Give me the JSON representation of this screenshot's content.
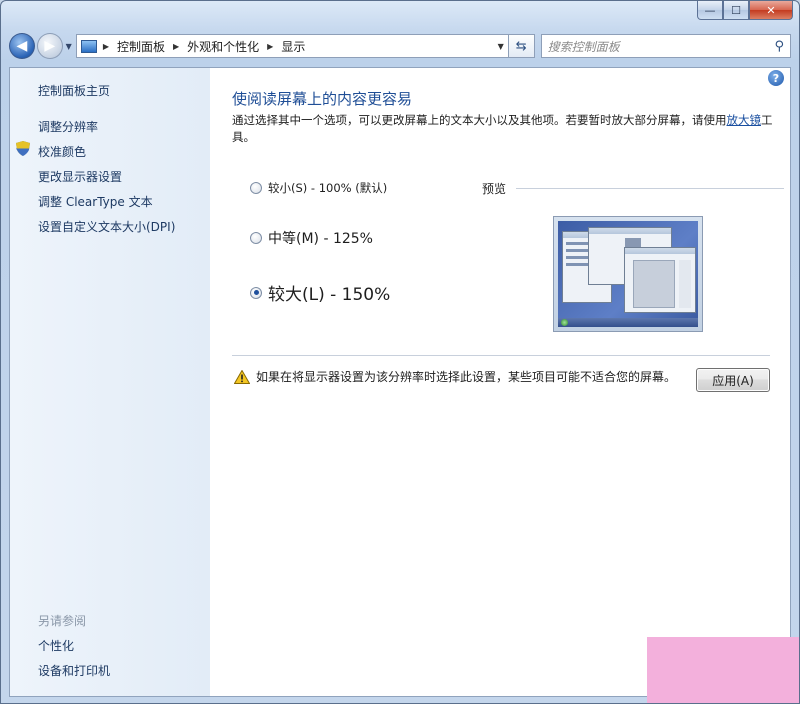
{
  "window": {
    "caption_buttons": {
      "minimize": "—",
      "maximize": "☐",
      "close": "✕"
    }
  },
  "navbar": {
    "back_icon": "arrow-left-icon",
    "forward_icon": "arrow-right-icon",
    "breadcrumbs": [
      "控制面板",
      "外观和个性化",
      "显示"
    ],
    "search_placeholder": "搜索控制面板"
  },
  "sidebar": {
    "items": [
      {
        "label": "控制面板主页"
      },
      {
        "label": "调整分辨率"
      },
      {
        "label": "校准颜色",
        "icon": "shield-icon"
      },
      {
        "label": "更改显示器设置"
      },
      {
        "label": "调整 ClearType 文本"
      },
      {
        "label": "设置自定义文本大小(DPI)"
      }
    ],
    "see_also_title": "另请参阅",
    "see_also": [
      {
        "label": "个性化"
      },
      {
        "label": "设备和打印机"
      }
    ]
  },
  "main": {
    "heading": "使阅读屏幕上的内容更容易",
    "description_prefix": "通过选择其中一个选项，可以更改屏幕上的文本大小以及其他项。若要暂时放大部分屏幕，请使用",
    "description_link": "放大镜",
    "description_suffix": "工具。",
    "options": [
      {
        "label": "较小(S) - 100% (默认)",
        "checked": false
      },
      {
        "label": "中等(M) - 125%",
        "checked": false
      },
      {
        "label": "较大(L) - 150%",
        "checked": true
      }
    ],
    "preview_label": "预览",
    "warning_text": "如果在将显示器设置为该分辨率时选择此设置，某些项目可能不适合您的屏幕。",
    "apply_label": "应用(A)",
    "help_label": "?"
  },
  "colors": {
    "link": "#1e3a63",
    "heading": "#1f4e96",
    "corner_overlay": "#f3b0dc"
  }
}
